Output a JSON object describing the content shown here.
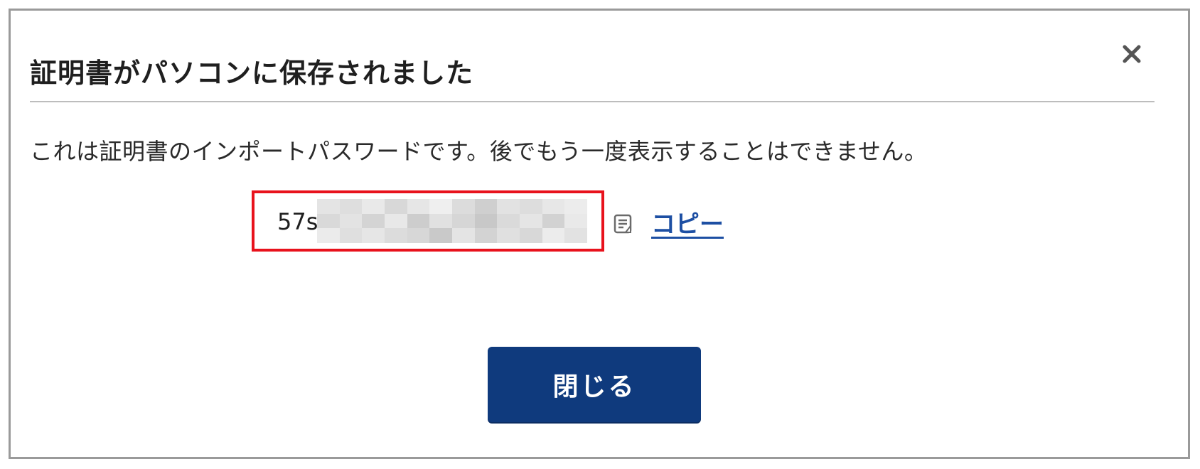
{
  "dialog": {
    "title": "証明書がパソコンに保存されました",
    "close_icon": "close-icon",
    "message": "これは証明書のインポートパスワードです。後でもう一度表示することはできません。",
    "password": {
      "visible_prefix": "57s",
      "obscured": true
    },
    "copy": {
      "icon": "copy-icon",
      "label": "コピー"
    },
    "close_button_label": "閉じる"
  },
  "colors": {
    "highlight_border": "#e8121c",
    "primary_button": "#0f3a7d",
    "link": "#1d4fa3",
    "frame_border": "#9a9a9a"
  }
}
